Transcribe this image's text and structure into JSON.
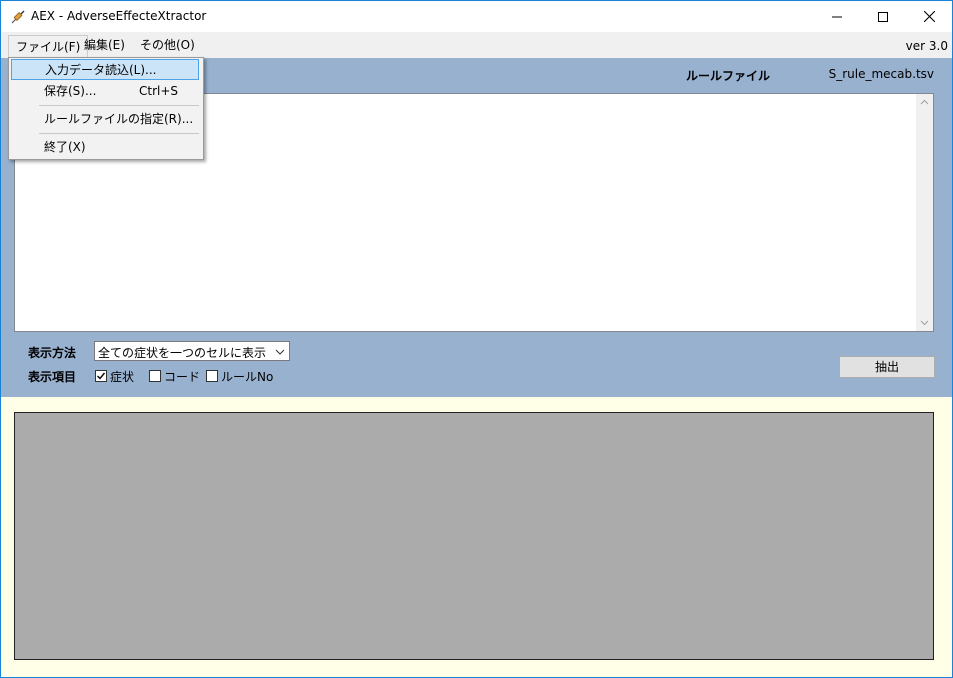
{
  "window": {
    "title": "AEX - AdverseEffecteXtractor"
  },
  "menubar": {
    "items": [
      {
        "label": "ファイル(F)"
      },
      {
        "label": "編集(E)"
      },
      {
        "label": "その他(O)"
      }
    ],
    "version": "ver 3.0"
  },
  "file_menu": {
    "items": [
      {
        "label": "入力データ読込(L)...",
        "shortcut": ""
      },
      {
        "label": "保存(S)...",
        "shortcut": "Ctrl+S"
      },
      {
        "label": "ルールファイルの指定(R)...",
        "shortcut": ""
      },
      {
        "label": "終了(X)",
        "shortcut": ""
      }
    ]
  },
  "top": {
    "rule_file_label": "ルールファイル",
    "rule_file_name": "S_rule_mecab.tsv"
  },
  "options": {
    "display_method_label": "表示方法",
    "display_method_value": "全ての症状を一つのセルに表示",
    "display_items_label": "表示項目",
    "checkboxes": [
      {
        "label": "症状",
        "checked": true
      },
      {
        "label": "コード",
        "checked": false
      },
      {
        "label": "ルールNo",
        "checked": false
      }
    ],
    "extract_label": "抽出"
  }
}
